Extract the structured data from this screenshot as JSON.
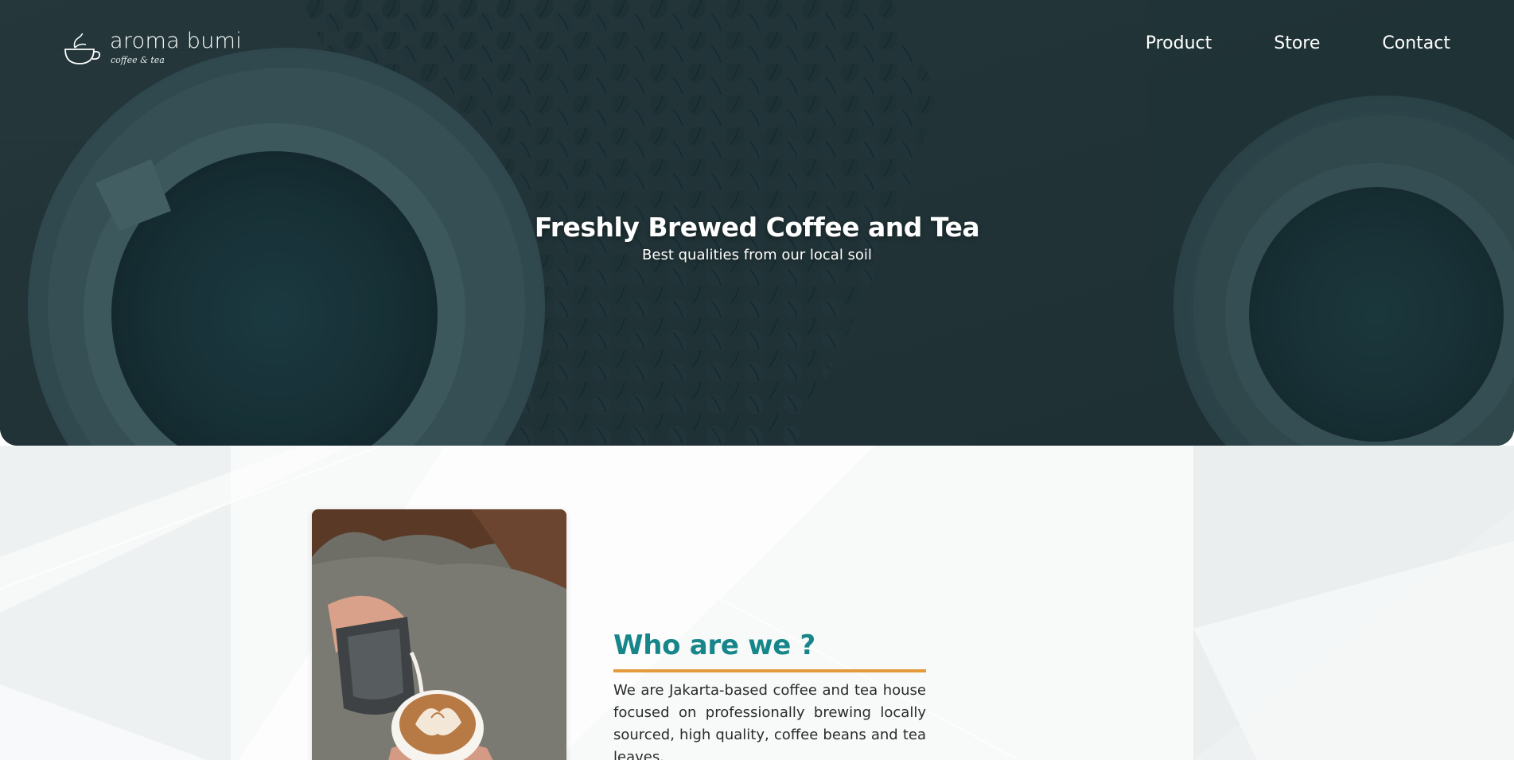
{
  "brand": {
    "name": "aroma bumi",
    "tagline": "coffee & tea",
    "logo_icon": "teacup-icon"
  },
  "nav": {
    "items": [
      {
        "label": "Product"
      },
      {
        "label": "Store"
      },
      {
        "label": "Contact"
      }
    ]
  },
  "hero": {
    "title": "Freshly Brewed Coffee and Tea",
    "subtitle": "Best qualities from our local soil",
    "background": "coffee-cups-and-beans-photo"
  },
  "about": {
    "heading": "Who are we ?",
    "body": "We are Jakarta-based coffee and tea house focused on professionally brewing locally sourced, high quality, coffee beans and tea leaves.",
    "photo": "barista-latte-art-photo"
  },
  "colors": {
    "accent_teal": "#16868a",
    "accent_orange": "#e59b3b",
    "hero_tint": "#1c3a40"
  }
}
